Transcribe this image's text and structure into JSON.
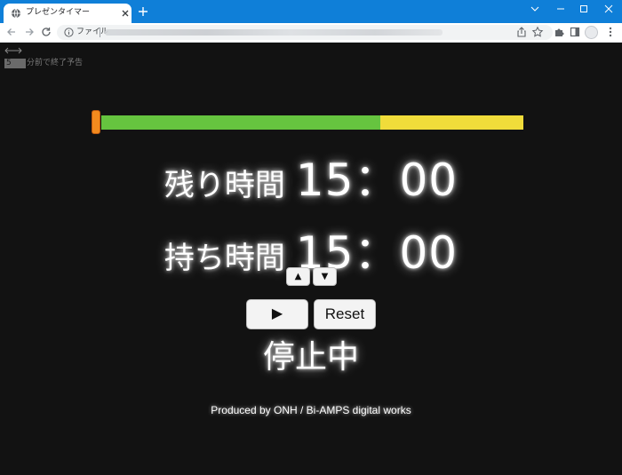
{
  "browser": {
    "tab_title": "プレゼンタイマー",
    "address_scheme_label": "ファイル",
    "accent_color": "#0f7fd8"
  },
  "icons": {
    "tab_favicon": "globe-icon",
    "tab_close": "close-icon",
    "new_tab": "plus-icon",
    "back": "back-arrow-icon",
    "forward": "forward-arrow-icon",
    "reload": "reload-icon",
    "site_info": "info-icon",
    "share": "share-icon",
    "bookmark": "star-icon",
    "extensions": "puzzle-icon",
    "side_panel": "side-panel-icon",
    "menu": "kebab-menu-icon",
    "resize": "horizontal-resize-icon"
  },
  "settings": {
    "warning_minutes": "5",
    "warning_label": "分前で終了予告"
  },
  "progress": {
    "elapsed_fraction": 0.66,
    "fill_color": "#66c43f",
    "track_color": "#f0dc3a",
    "handle_color": "#f28a1e"
  },
  "timers": {
    "remaining_label": "残り時間",
    "remaining_value": "15：00",
    "holding_label": "持ち時間",
    "holding_value": "15：00"
  },
  "controls": {
    "up_label": "▲",
    "down_label": "▼",
    "play_label": "▶",
    "reset_label": "Reset"
  },
  "status": {
    "text": "停止中"
  },
  "footer": {
    "credit": "Produced by ONH / Bi-AMPS digital works"
  }
}
